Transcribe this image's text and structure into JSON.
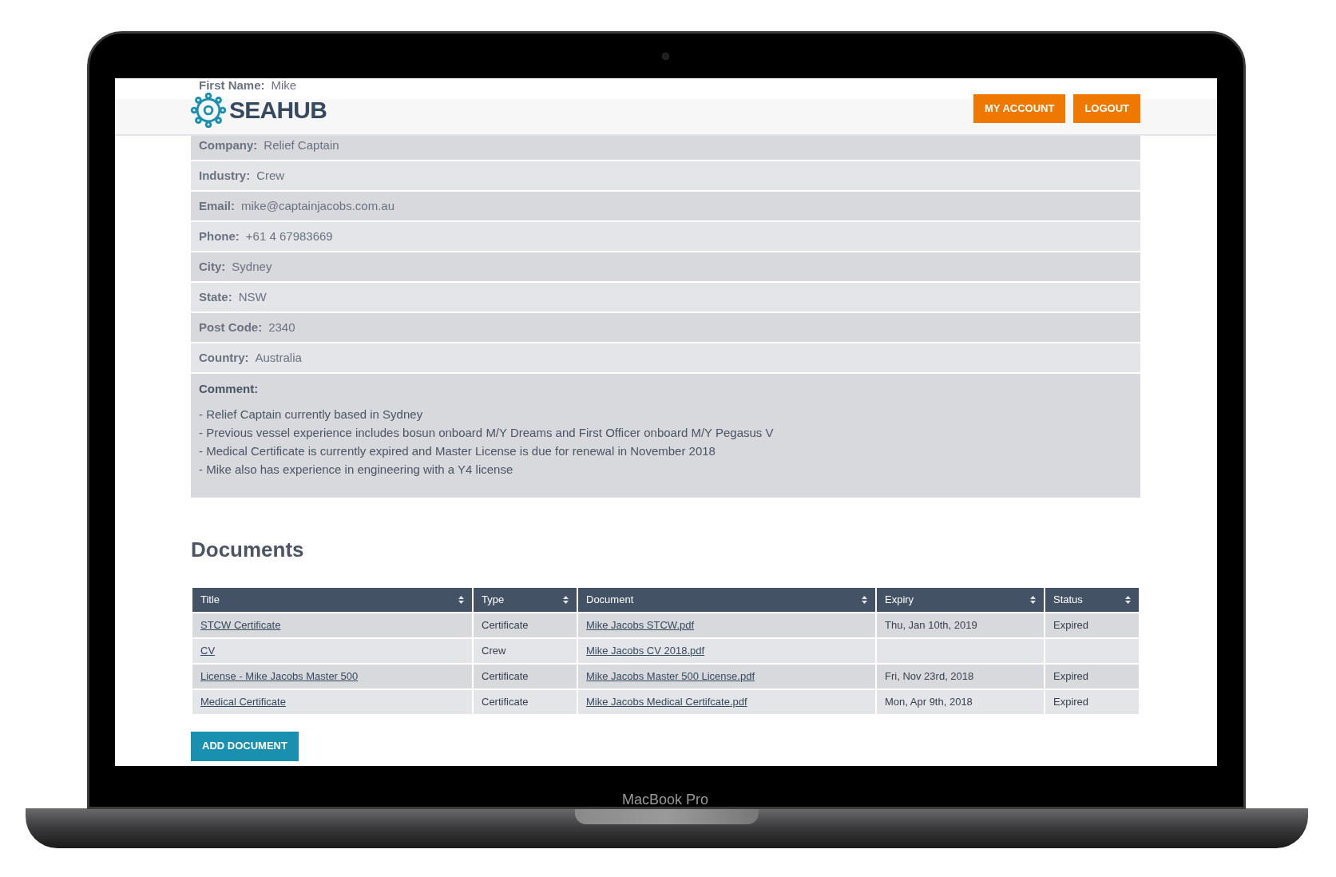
{
  "brand": "SEAHUB",
  "header_buttons": [
    "MY ACCOUNT",
    "LOGOUT"
  ],
  "profile": [
    {
      "label": "First Name:",
      "value": "Mike"
    },
    {
      "label": "Company:",
      "value": "Relief Captain"
    },
    {
      "label": "Industry:",
      "value": "Crew"
    },
    {
      "label": "Email:",
      "value": "mike@captainjacobs.com.au"
    },
    {
      "label": "Phone:",
      "value": "+61 4 67983669"
    },
    {
      "label": "City:",
      "value": "Sydney"
    },
    {
      "label": "State:",
      "value": "NSW"
    },
    {
      "label": "Post Code:",
      "value": "2340"
    },
    {
      "label": "Country:",
      "value": "Australia"
    }
  ],
  "comment": {
    "label": "Comment:",
    "lines": [
      "- Relief Captain currently based in Sydney",
      "- Previous vessel experience includes bosun onboard M/Y Dreams and First Officer onboard M/Y Pegasus V",
      "- Medical Certificate is currently expired and Master License is due for renewal in November 2018",
      "- Mike also has experience in engineering with a Y4 license"
    ]
  },
  "documents": {
    "heading": "Documents",
    "columns": [
      "Title",
      "Type",
      "Document",
      "Expiry",
      "Status"
    ],
    "rows": [
      {
        "title": "STCW Certificate",
        "type": "Certificate",
        "document": "Mike Jacobs STCW.pdf",
        "expiry": "Thu, Jan 10th, 2019",
        "status": "Expired"
      },
      {
        "title": "CV",
        "type": "Crew",
        "document": "Mike Jacobs CV 2018.pdf"
      },
      {
        "title": "License - Mike Jacobs Master 500",
        "type": "Certificate",
        "document": "Mike Jacobs Master 500 License.pdf",
        "expiry": "Fri, Nov 23rd, 2018",
        "status": "Expired"
      },
      {
        "title": "Medical Certificate",
        "type": "Certificate",
        "document": "Mike Jacobs Medical Certifcate.pdf",
        "expiry": "Mon, Apr 9th, 2018",
        "status": "Expired"
      }
    ],
    "add_button": "ADD DOCUMENT"
  },
  "device_label": "MacBook Pro"
}
